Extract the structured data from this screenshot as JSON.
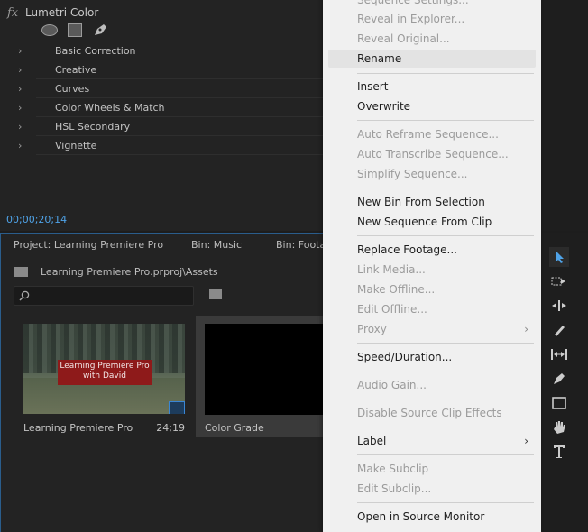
{
  "effect_controls": {
    "effect_name": "Lumetri Color",
    "fx_glyph": "fx",
    "sections": [
      "Basic Correction",
      "Creative",
      "Curves",
      "Color Wheels & Match",
      "HSL Secondary",
      "Vignette"
    ],
    "timecode": "00;00;20;14"
  },
  "project": {
    "tabs": [
      "Project: Learning Premiere Pro",
      "Bin: Music",
      "Bin: Footag"
    ],
    "path": "Learning Premiere Pro.prproj\\Assets",
    "search_value": "",
    "items": [
      {
        "name": "Learning Premiere Pro",
        "duration": "24;19",
        "title_text": "Learning Premiere Pro with David"
      },
      {
        "name": "Color Grade",
        "duration": ""
      }
    ]
  },
  "context_menu": {
    "items": [
      {
        "label": "Sequence Settings...",
        "disabled": true
      },
      {
        "label": "Reveal in Explorer...",
        "disabled": true
      },
      {
        "label": "Reveal Original...",
        "disabled": true
      },
      {
        "label": "Rename",
        "disabled": false,
        "highlighted": true
      },
      {
        "label": "Insert",
        "disabled": false
      },
      {
        "label": "Overwrite",
        "disabled": false
      },
      {
        "label": "Auto Reframe Sequence...",
        "disabled": true
      },
      {
        "label": "Auto Transcribe Sequence...",
        "disabled": true
      },
      {
        "label": "Simplify Sequence...",
        "disabled": true
      },
      {
        "label": "New Bin From Selection",
        "disabled": false
      },
      {
        "label": "New Sequence From Clip",
        "disabled": false
      },
      {
        "label": "Replace Footage...",
        "disabled": false
      },
      {
        "label": "Link Media...",
        "disabled": true
      },
      {
        "label": "Make Offline...",
        "disabled": true
      },
      {
        "label": "Edit Offline...",
        "disabled": true
      },
      {
        "label": "Proxy",
        "disabled": true,
        "submenu": true
      },
      {
        "label": "Speed/Duration...",
        "disabled": false
      },
      {
        "label": "Audio Gain...",
        "disabled": true
      },
      {
        "label": "Disable Source Clip Effects",
        "disabled": true
      },
      {
        "label": "Label",
        "disabled": false,
        "submenu": true
      },
      {
        "label": "Make Subclip",
        "disabled": true
      },
      {
        "label": "Edit Subclip...",
        "disabled": true
      },
      {
        "label": "Open in Source Monitor",
        "disabled": false
      }
    ]
  },
  "tools": [
    "selection-tool-icon",
    "track-select-forward-icon",
    "ripple-edit-icon",
    "razor-icon",
    "slip-icon",
    "pen-icon",
    "rectangle-icon",
    "hand-icon",
    "type-icon"
  ],
  "colors": {
    "accent": "#4fa3e8",
    "menu_bg": "#f0f0f0",
    "title_banner": "#8e1a1a"
  }
}
